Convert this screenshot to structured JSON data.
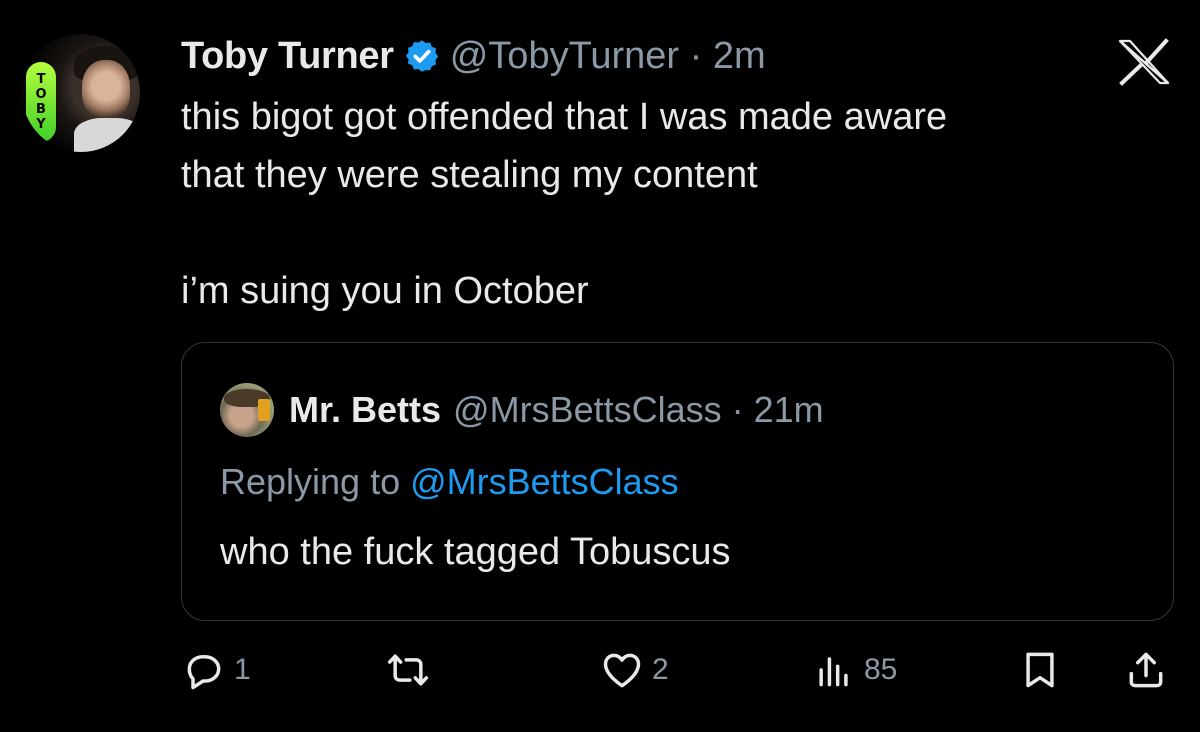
{
  "author": {
    "display_name": "Toby Turner",
    "handle_time": "@TobyTurner · 2m",
    "avatar_text": [
      "T",
      "O",
      "B",
      "Y"
    ],
    "verified_icon": "verified-badge-icon"
  },
  "tweet": {
    "line1": "this bigot got offended that I was made aware",
    "line2": "that they were stealing my content",
    "line3": "i’m suing you in October"
  },
  "quote": {
    "display_name": "Mr. Betts",
    "handle_time": "@MrsBettsClass · 21m",
    "replying_prefix": "Replying to ",
    "replying_mention": "@MrsBettsClass",
    "text": "who the fuck tagged Tobuscus"
  },
  "actions": {
    "reply_count": "1",
    "retweet_count": "",
    "like_count": "2",
    "views_count": "85"
  },
  "colors": {
    "background": "#000000",
    "text": "#e7e9ea",
    "secondary": "#8b98a5",
    "accent": "#1d9bf0"
  }
}
